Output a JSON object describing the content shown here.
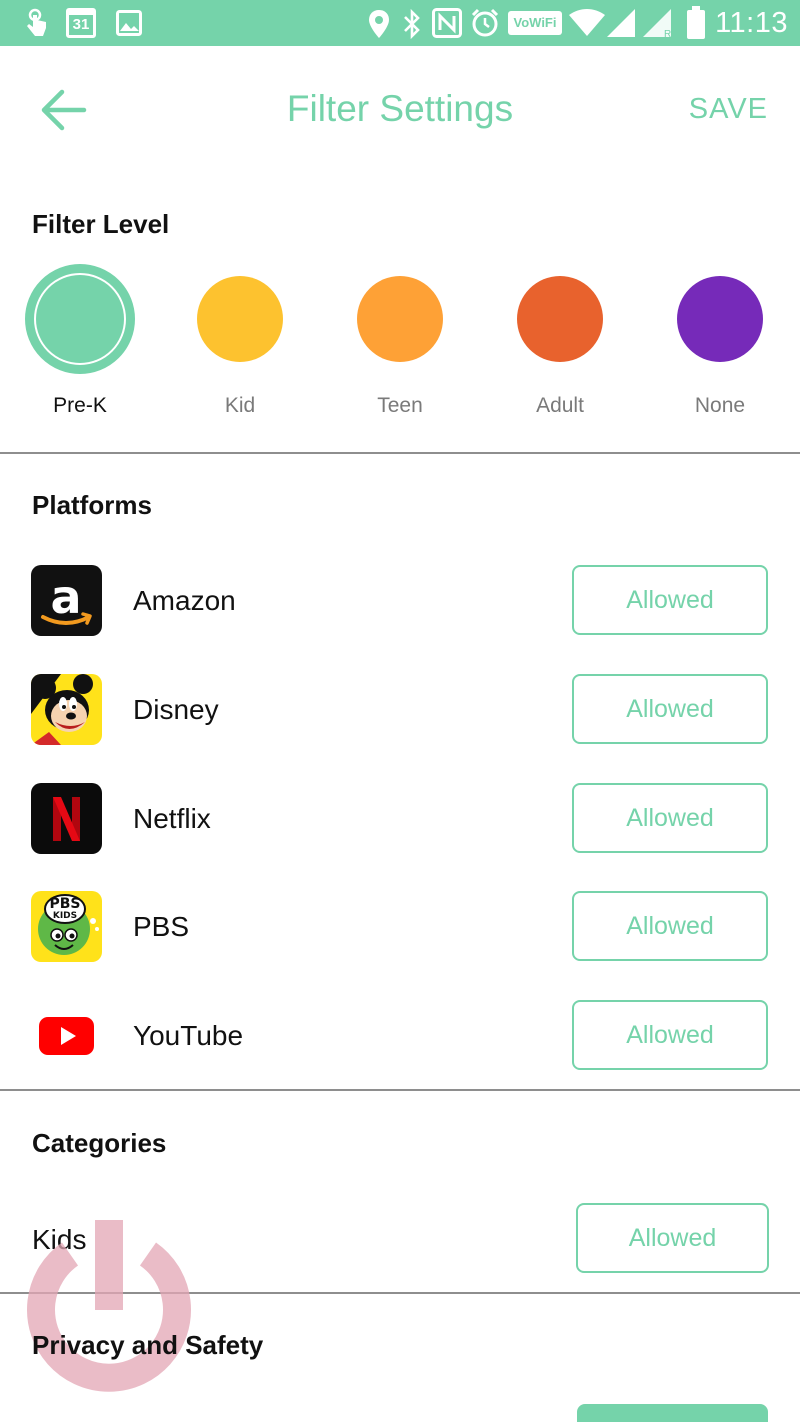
{
  "status_bar": {
    "time": "11:13",
    "calendar_day": "31",
    "vowifi": "VoWiFi",
    "icons": [
      "touch-notification-icon",
      "calendar-icon",
      "image-icon",
      "location-icon",
      "bluetooth-icon",
      "nfc-icon",
      "alarm-icon",
      "vowifi-icon",
      "wifi-icon",
      "signal-icon",
      "signal-roaming-icon",
      "battery-icon"
    ],
    "background_color": "#75d3aa"
  },
  "app_bar": {
    "title": "Filter Settings",
    "save_label": "SAVE",
    "back_icon": "arrow-left-icon",
    "accent_color": "#75d3aa"
  },
  "filter_level": {
    "title": "Filter Level",
    "levels": [
      {
        "label": "Pre-K",
        "color": "#75d3aa",
        "selected": true
      },
      {
        "label": "Kid",
        "color": "#fdc22f",
        "selected": false
      },
      {
        "label": "Teen",
        "color": "#fea136",
        "selected": false
      },
      {
        "label": "Adult",
        "color": "#e8622d",
        "selected": false
      },
      {
        "label": "None",
        "color": "#762ab9",
        "selected": false
      }
    ]
  },
  "platforms": {
    "title": "Platforms",
    "items": [
      {
        "name": "Amazon",
        "status": "Allowed",
        "icon": "amazon-logo-icon"
      },
      {
        "name": "Disney",
        "status": "Allowed",
        "icon": "disney-mickey-logo-icon"
      },
      {
        "name": "Netflix",
        "status": "Allowed",
        "icon": "netflix-logo-icon"
      },
      {
        "name": "PBS",
        "status": "Allowed",
        "icon": "pbs-kids-logo-icon",
        "logo_text": "PBS",
        "logo_subtext": "KIDS"
      },
      {
        "name": "YouTube",
        "status": "Allowed",
        "icon": "youtube-logo-icon"
      }
    ]
  },
  "categories": {
    "title": "Categories",
    "items": [
      {
        "name": "Kids",
        "status": "Allowed"
      }
    ]
  },
  "privacy": {
    "title": "Privacy and Safety"
  },
  "watermark_icon": "power-icon"
}
